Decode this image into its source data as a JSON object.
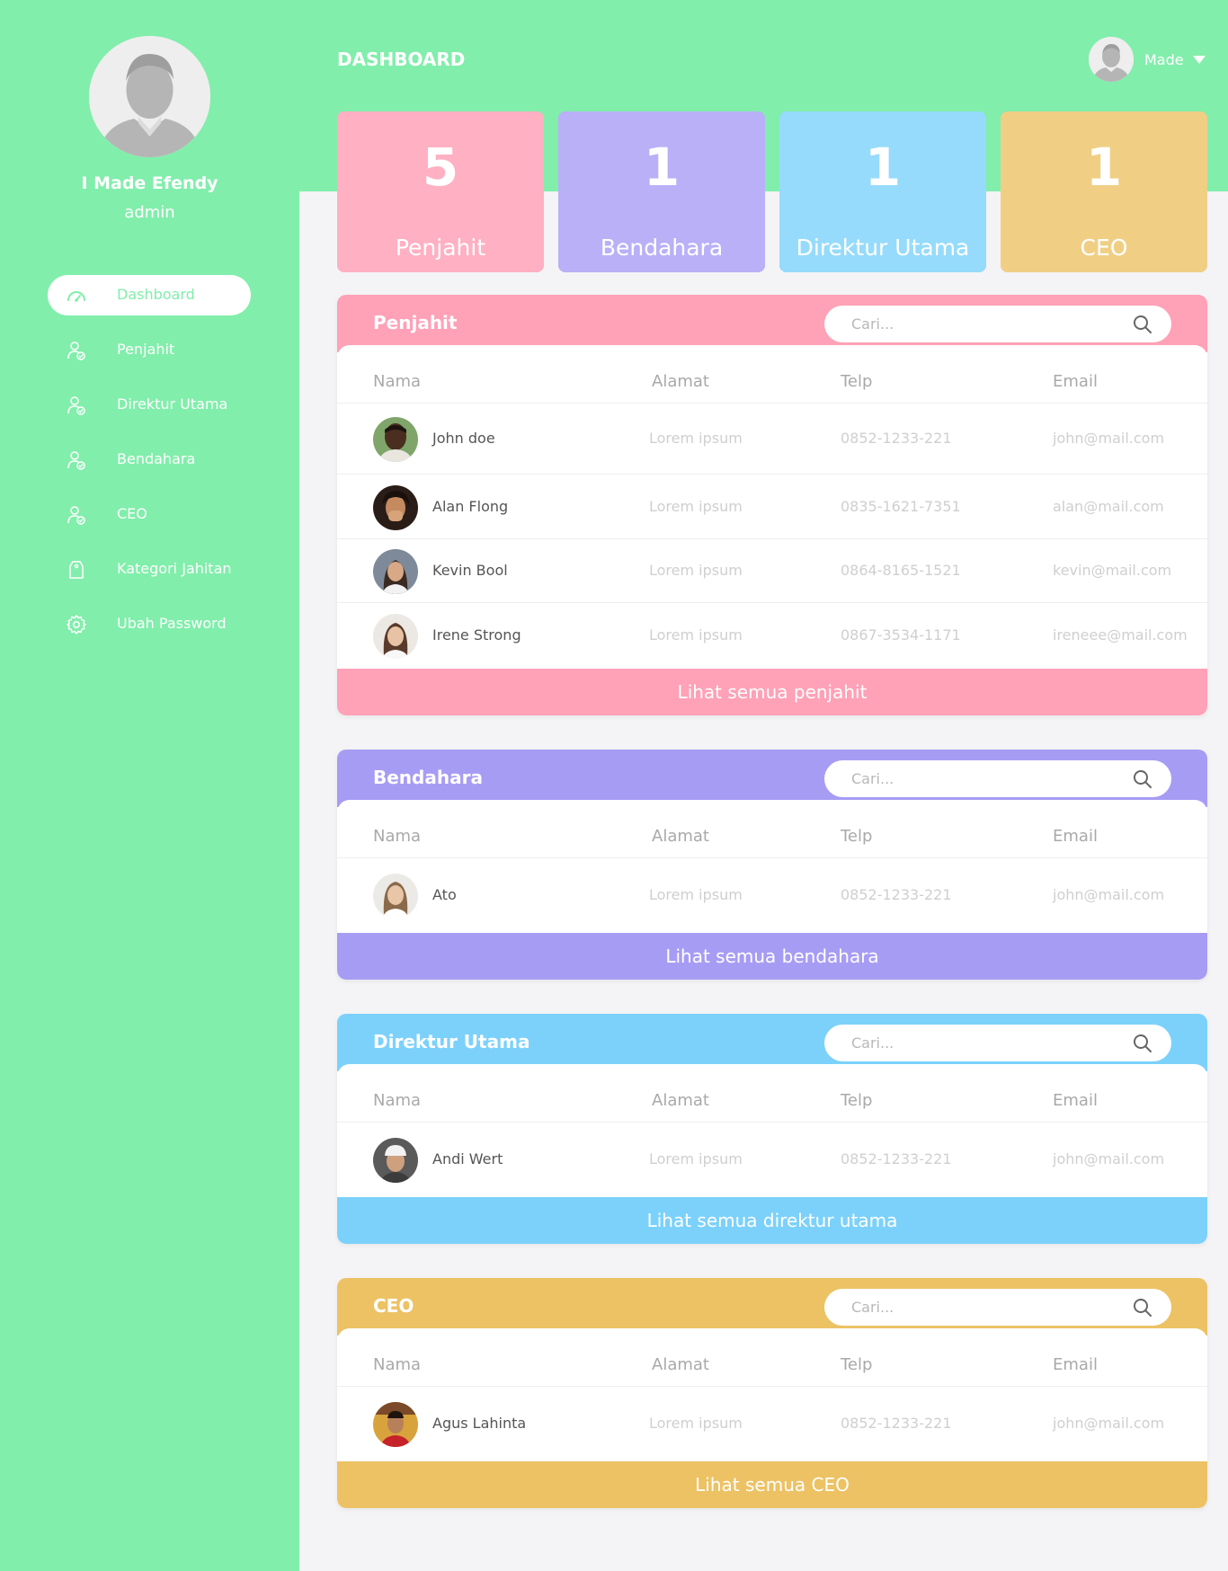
{
  "colors": {
    "green": "#81eeab",
    "pink": "#ffa1b7",
    "purple": "#a79cf4",
    "blue": "#7cd1fb",
    "orange": "#ecc264"
  },
  "sidebar": {
    "name": "I Made Efendy",
    "role": "admin",
    "items": [
      {
        "label": "Dashboard",
        "icon": "gauge-icon"
      },
      {
        "label": "Penjahit",
        "icon": "user-check-icon"
      },
      {
        "label": "Direktur Utama",
        "icon": "user-check-icon"
      },
      {
        "label": "Bendahara",
        "icon": "user-check-icon"
      },
      {
        "label": "CEO",
        "icon": "user-check-icon"
      },
      {
        "label": "Kategori Jahitan",
        "icon": "tag-icon"
      },
      {
        "label": "Ubah Password",
        "icon": "gear-icon"
      }
    ]
  },
  "header": {
    "title": "DASHBOARD",
    "user": "Made"
  },
  "stats": [
    {
      "count": "5",
      "label": "Penjahit"
    },
    {
      "count": "1",
      "label": "Bendahara"
    },
    {
      "count": "1",
      "label": "Direktur Utama"
    },
    {
      "count": "1",
      "label": "CEO"
    }
  ],
  "columns": {
    "nama": "Nama",
    "alamat": "Alamat",
    "telp": "Telp",
    "email": "Email"
  },
  "search_placeholder": "Cari...",
  "panels": {
    "penjahit": {
      "title": "Penjahit",
      "footer": "Lihat semua penjahit",
      "rows": [
        {
          "name": "John doe",
          "alamat": "Lorem ipsum",
          "telp": "0852-1233-221",
          "email": "john@mail.com"
        },
        {
          "name": "Alan Flong",
          "alamat": "Lorem ipsum",
          "telp": "0835-1621-7351",
          "email": "alan@mail.com"
        },
        {
          "name": "Kevin Bool",
          "alamat": "Lorem ipsum",
          "telp": "0864-8165-1521",
          "email": "kevin@mail.com"
        },
        {
          "name": "Irene Strong",
          "alamat": "Lorem ipsum",
          "telp": "0867-3534-1171",
          "email": "ireneee@mail.com"
        }
      ]
    },
    "bendahara": {
      "title": "Bendahara",
      "footer": "Lihat semua bendahara",
      "rows": [
        {
          "name": "Ato",
          "alamat": "Lorem ipsum",
          "telp": "0852-1233-221",
          "email": "john@mail.com"
        }
      ]
    },
    "direktur": {
      "title": "Direktur Utama",
      "footer": "Lihat semua direktur utama",
      "rows": [
        {
          "name": "Andi Wert",
          "alamat": "Lorem ipsum",
          "telp": "0852-1233-221",
          "email": "john@mail.com"
        }
      ]
    },
    "ceo": {
      "title": "CEO",
      "footer": "Lihat semua CEO",
      "rows": [
        {
          "name": "Agus Lahinta",
          "alamat": "Lorem ipsum",
          "telp": "0852-1233-221",
          "email": "john@mail.com"
        }
      ]
    }
  }
}
